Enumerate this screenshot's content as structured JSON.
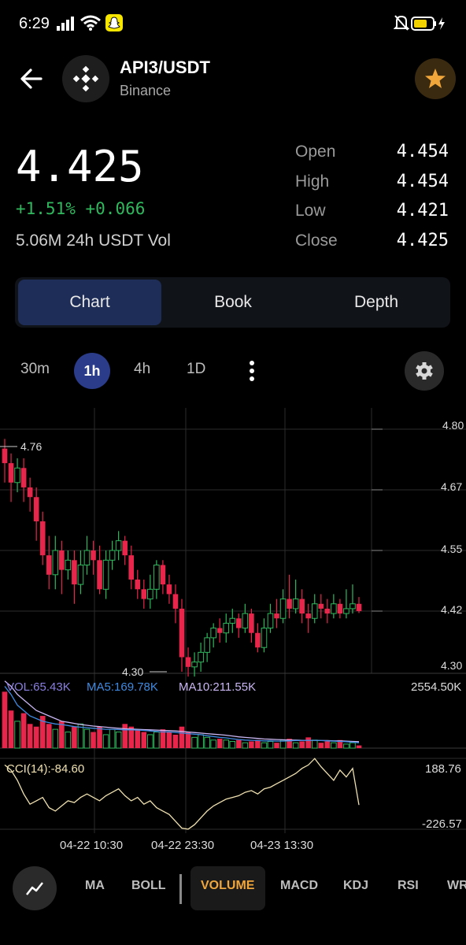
{
  "status_bar": {
    "time": "6:29"
  },
  "header": {
    "pair": "API3/USDT",
    "exchange": "Binance"
  },
  "ticker": {
    "price": "4.425",
    "change_percent": "+1.51%",
    "change_abs": "+0.066",
    "volume_24h": "5.06M 24h USDT Vol",
    "open_label": "Open",
    "open_value": "4.454",
    "high_label": "High",
    "high_value": "4.454",
    "low_label": "Low",
    "low_value": "4.421",
    "close_label": "Close",
    "close_value": "4.425"
  },
  "tabs": [
    {
      "label": "Chart",
      "active": true
    },
    {
      "label": "Book",
      "active": false
    },
    {
      "label": "Depth",
      "active": false
    }
  ],
  "timeframes": {
    "t1": "30m",
    "t2": "1h",
    "t3": "4h",
    "t4": "1D",
    "active": "1h"
  },
  "price_axis": {
    "p1": "4.80",
    "p2": "4.67",
    "p3": "4.55",
    "p4": "4.42",
    "p5": "4.30"
  },
  "chart_markers": {
    "high_marker": "4.76",
    "low_marker": "4.30"
  },
  "volume_panel": {
    "vol": "VOL:65.43K",
    "ma5": "MA5:169.78K",
    "ma10": "MA10:211.55K",
    "max": "2554.50K"
  },
  "cci_panel": {
    "label": "CCI(14):-84.60",
    "max": "188.76",
    "min": "-226.57"
  },
  "time_axis": {
    "t1": "04-22 10:30",
    "t2": "04-22 23:30",
    "t3": "04-23 13:30"
  },
  "bottom_bar": {
    "items": [
      "MA",
      "BOLL",
      "VOLUME",
      "MACD",
      "KDJ",
      "RSI",
      "WR"
    ],
    "active": "VOLUME"
  },
  "colors": {
    "up": "#2fb85d",
    "down": "#e8254a",
    "accent": "#f0a63a",
    "active_tab": "#1e2d57"
  },
  "chart_data": {
    "type": "candlestick",
    "title": "",
    "ylim": [
      4.28,
      4.82
    ],
    "candles": [
      [
        4.76,
        4.73,
        4.78,
        4.69
      ],
      [
        4.73,
        4.69,
        4.75,
        4.65
      ],
      [
        4.69,
        4.72,
        4.74,
        4.67
      ],
      [
        4.72,
        4.68,
        4.74,
        4.65
      ],
      [
        4.68,
        4.66,
        4.7,
        4.63
      ],
      [
        4.66,
        4.61,
        4.68,
        4.57
      ],
      [
        4.61,
        4.54,
        4.63,
        4.52
      ],
      [
        4.54,
        4.5,
        4.58,
        4.47
      ],
      [
        4.5,
        4.55,
        4.58,
        4.47
      ],
      [
        4.55,
        4.51,
        4.57,
        4.46
      ],
      [
        4.51,
        4.53,
        4.55,
        4.49
      ],
      [
        4.53,
        4.48,
        4.55,
        4.44
      ],
      [
        4.48,
        4.52,
        4.55,
        4.46
      ],
      [
        4.52,
        4.55,
        4.58,
        4.5
      ],
      [
        4.55,
        4.53,
        4.57,
        4.5
      ],
      [
        4.53,
        4.47,
        4.56,
        4.46
      ],
      [
        4.47,
        4.53,
        4.55,
        4.45
      ],
      [
        4.53,
        4.55,
        4.57,
        4.51
      ],
      [
        4.55,
        4.57,
        4.59,
        4.53
      ],
      [
        4.57,
        4.54,
        4.58,
        4.52
      ],
      [
        4.54,
        4.49,
        4.56,
        4.47
      ],
      [
        4.49,
        4.47,
        4.51,
        4.45
      ],
      [
        4.47,
        4.45,
        4.49,
        4.43
      ],
      [
        4.45,
        4.47,
        4.5,
        4.43
      ],
      [
        4.47,
        4.52,
        4.53,
        4.45
      ],
      [
        4.52,
        4.48,
        4.53,
        4.46
      ],
      [
        4.48,
        4.46,
        4.5,
        4.44
      ],
      [
        4.46,
        4.43,
        4.48,
        4.4
      ],
      [
        4.43,
        4.33,
        4.45,
        4.3
      ],
      [
        4.33,
        4.31,
        4.35,
        4.29
      ],
      [
        4.31,
        4.32,
        4.34,
        4.29
      ],
      [
        4.32,
        4.34,
        4.36,
        4.3
      ],
      [
        4.34,
        4.37,
        4.38,
        4.32
      ],
      [
        4.37,
        4.39,
        4.4,
        4.35
      ],
      [
        4.39,
        4.38,
        4.41,
        4.36
      ],
      [
        4.38,
        4.4,
        4.42,
        4.36
      ],
      [
        4.4,
        4.41,
        4.43,
        4.38
      ],
      [
        4.41,
        4.39,
        4.42,
        4.37
      ],
      [
        4.39,
        4.42,
        4.44,
        4.38
      ],
      [
        4.42,
        4.38,
        4.43,
        4.36
      ],
      [
        4.38,
        4.35,
        4.4,
        4.34
      ],
      [
        4.35,
        4.39,
        4.41,
        4.34
      ],
      [
        4.39,
        4.42,
        4.44,
        4.38
      ],
      [
        4.42,
        4.41,
        4.45,
        4.39
      ],
      [
        4.41,
        4.45,
        4.47,
        4.4
      ],
      [
        4.45,
        4.43,
        4.5,
        4.41
      ],
      [
        4.43,
        4.45,
        4.49,
        4.42
      ],
      [
        4.45,
        4.42,
        4.47,
        4.4
      ],
      [
        4.42,
        4.41,
        4.44,
        4.38
      ],
      [
        4.41,
        4.44,
        4.46,
        4.4
      ],
      [
        4.44,
        4.43,
        4.46,
        4.41
      ],
      [
        4.43,
        4.42,
        4.45,
        4.4
      ],
      [
        4.42,
        4.44,
        4.46,
        4.41
      ],
      [
        4.44,
        4.42,
        4.45,
        4.41
      ],
      [
        4.42,
        4.43,
        4.47,
        4.41
      ],
      [
        4.43,
        4.44,
        4.48,
        4.42
      ],
      [
        4.44,
        4.425,
        4.454,
        4.421
      ]
    ],
    "volume": [
      2.1,
      1.4,
      1.0,
      1.3,
      0.9,
      0.8,
      1.2,
      0.9,
      0.7,
      1.0,
      0.6,
      0.8,
      0.9,
      0.7,
      0.6,
      0.8,
      0.5,
      0.7,
      0.6,
      0.9,
      0.8,
      0.7,
      0.6,
      0.5,
      0.6,
      0.7,
      0.6,
      0.5,
      0.8,
      0.6,
      0.4,
      0.5,
      0.4,
      0.3,
      0.35,
      0.3,
      0.25,
      0.3,
      0.2,
      0.25,
      0.3,
      0.2,
      0.25,
      0.2,
      0.3,
      0.35,
      0.2,
      0.25,
      0.4,
      0.3,
      0.2,
      0.25,
      0.2,
      0.3,
      0.15,
      0.2,
      0.1
    ],
    "ma5": [
      2.3,
      2.0,
      1.6,
      1.4,
      1.2,
      1.1,
      1.0,
      0.95,
      0.9,
      0.88,
      0.84,
      0.8,
      0.78,
      0.76,
      0.74,
      0.72,
      0.7,
      0.7,
      0.69,
      0.68,
      0.68,
      0.67,
      0.66,
      0.64,
      0.62,
      0.6,
      0.6,
      0.58,
      0.56,
      0.54,
      0.52,
      0.5,
      0.46,
      0.43,
      0.4,
      0.38,
      0.35,
      0.32,
      0.3,
      0.29,
      0.28,
      0.27,
      0.27,
      0.26,
      0.26,
      0.27,
      0.28,
      0.28,
      0.29,
      0.29,
      0.28,
      0.27,
      0.26,
      0.25,
      0.24,
      0.22,
      0.2
    ],
    "ma10": [
      2.5,
      2.3,
      2.0,
      1.8,
      1.6,
      1.4,
      1.3,
      1.2,
      1.1,
      1.0,
      0.96,
      0.92,
      0.88,
      0.85,
      0.82,
      0.8,
      0.78,
      0.76,
      0.74,
      0.72,
      0.71,
      0.7,
      0.69,
      0.68,
      0.67,
      0.66,
      0.65,
      0.64,
      0.62,
      0.6,
      0.58,
      0.56,
      0.54,
      0.52,
      0.5,
      0.48,
      0.45,
      0.42,
      0.4,
      0.38,
      0.36,
      0.34,
      0.33,
      0.32,
      0.31,
      0.3,
      0.3,
      0.29,
      0.29,
      0.29,
      0.28,
      0.28,
      0.27,
      0.27,
      0.26,
      0.25,
      0.24
    ],
    "cci": [
      150,
      120,
      60,
      -20,
      -80,
      -60,
      -40,
      -100,
      -120,
      -90,
      -60,
      -70,
      -40,
      -20,
      -40,
      -60,
      -30,
      -10,
      10,
      -30,
      -60,
      -40,
      -80,
      -60,
      -100,
      -120,
      -140,
      -180,
      -220,
      -226,
      -200,
      -160,
      -120,
      -90,
      -70,
      -50,
      -40,
      -30,
      -10,
      0,
      -20,
      10,
      20,
      40,
      60,
      80,
      100,
      130,
      150,
      188,
      140,
      100,
      60,
      120,
      80,
      130,
      -84.6
    ]
  }
}
